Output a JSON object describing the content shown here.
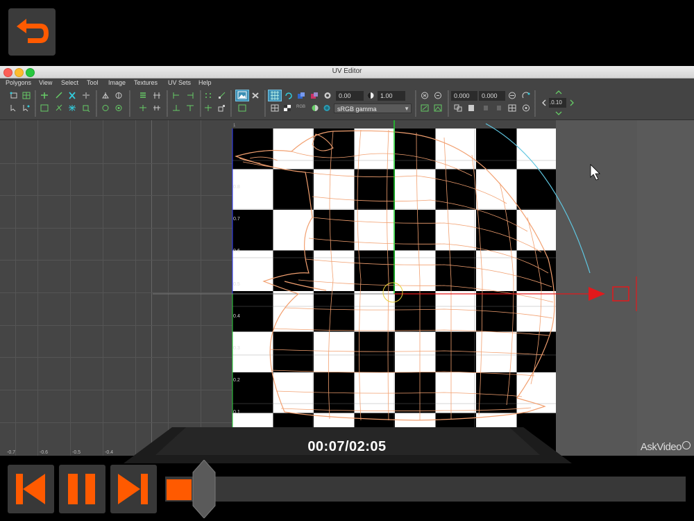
{
  "window": {
    "title": "UV Editor"
  },
  "menu": [
    "Polygons",
    "View",
    "Select",
    "Tool",
    "Image",
    "Textures",
    "UV Sets",
    "Help"
  ],
  "toolbar": {
    "exposure": "0.00",
    "gamma": "1.00",
    "color_space": "sRGB gamma",
    "u_value": "0.000",
    "v_value": "0.000",
    "step": ".0.10",
    "rgb_label": "RGB"
  },
  "uv_ticks": {
    "v": [
      "1",
      "0.8",
      "0.7",
      "0.6",
      "0.5",
      "0.4",
      "0.3",
      "0.2",
      "0.1"
    ],
    "u": [
      "-0.7",
      "-0.6",
      "-0.5",
      "-0.4"
    ]
  },
  "watermark": "AskVideo",
  "player": {
    "current_time": "00:07",
    "total_time": "02:05",
    "time_display": "00:07/02:05",
    "progress": 0.056
  },
  "colors": {
    "accent": "#ff5a00",
    "wireframe": "#f2a070",
    "manipulator_u": "#e3191c",
    "manipulator_v": "#1ccf2b",
    "rotate_arc": "#5fc6e0"
  },
  "icons": {
    "back": "back-arrow-icon",
    "prev": "skip-previous-icon",
    "pause": "pause-icon",
    "next": "skip-next-icon"
  }
}
